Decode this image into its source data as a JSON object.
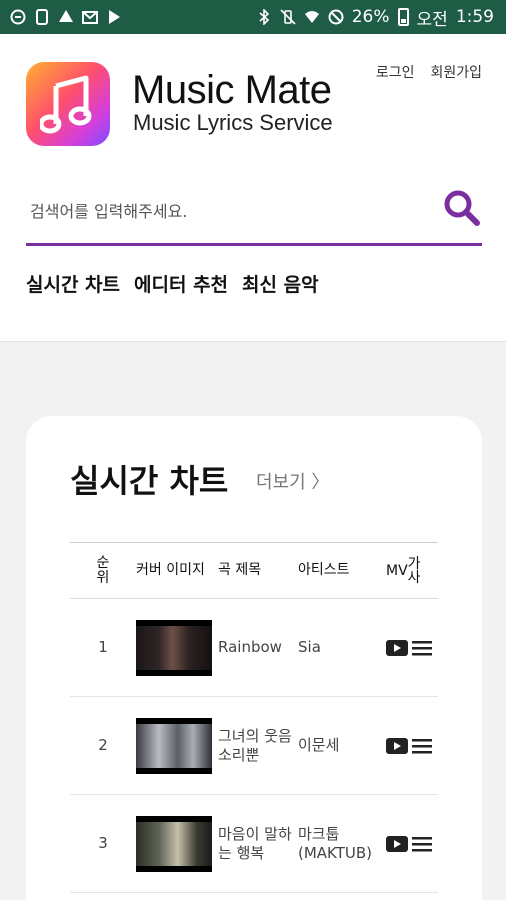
{
  "status_bar": {
    "battery": "26%",
    "ampm": "오전",
    "time": "1:59"
  },
  "header": {
    "app_title": "Music Mate",
    "app_subtitle": "Music Lyrics Service",
    "login": "로그인",
    "signup": "회원가입"
  },
  "search": {
    "placeholder": "검색어를 입력해주세요."
  },
  "nav": {
    "items": [
      {
        "label": "실시간 차트"
      },
      {
        "label": "에디터 추천"
      },
      {
        "label": "최신 음악"
      }
    ]
  },
  "chart": {
    "title": "실시간 차트",
    "more": "더보기 〉",
    "columns": {
      "rank_1": "순",
      "rank_2": "위",
      "cover": "커버 이미지",
      "title": "곡 제목",
      "artist": "아티스트",
      "mv": "MV",
      "lyrics_1": "가",
      "lyrics_2": "사"
    },
    "rows": [
      {
        "rank": "1",
        "title": "Rainbow",
        "artist": "Sia"
      },
      {
        "rank": "2",
        "title": "그녀의 웃음소리뿐",
        "artist": "이문세"
      },
      {
        "rank": "3",
        "title": "마음이 말하는 행복",
        "artist": "마크툽 (MAKTUB)"
      }
    ]
  },
  "colors": {
    "status_bar": "#1f5c46",
    "accent": "#7a2ea0",
    "background": "#f2f2f2"
  }
}
